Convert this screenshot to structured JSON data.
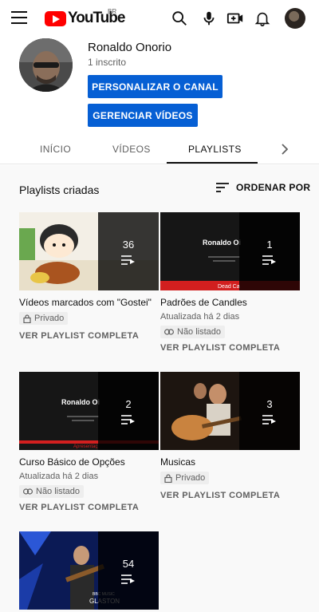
{
  "topbar": {
    "logo_text": "YouTube",
    "region": "BR",
    "icons": [
      "menu-icon",
      "search-icon",
      "microphone-icon",
      "create-video-icon",
      "notifications-icon",
      "avatar"
    ]
  },
  "channel": {
    "name": "Ronaldo Onorio",
    "subscribers": "1 inscrito",
    "customize_label": "PERSONALIZAR O CANAL",
    "manage_label": "GERENCIAR VÍDEOS"
  },
  "tabs": [
    {
      "label": "INÍCIO"
    },
    {
      "label": "VÍDEOS"
    },
    {
      "label": "PLAYLISTS",
      "active": true
    }
  ],
  "section": {
    "title": "Playlists criadas",
    "sort_label": "ORDENAR POR"
  },
  "playlists": [
    {
      "count": "36",
      "title": "Vídeos marcados com \"Gostei\"",
      "updated": "",
      "visibility": "Privado",
      "view_label": "VER PLAYLIST COMPLETA"
    },
    {
      "count": "1",
      "title": "Padrões de Candles",
      "updated": "Atualizada há 2 dias",
      "visibility": "Não listado",
      "view_label": "VER PLAYLIST COMPLETA",
      "thumb_title": "Ronaldo Oi",
      "thumb_footer": "Dead Ca"
    },
    {
      "count": "2",
      "title": "Curso Básico de Opções",
      "updated": "Atualizada há 2 dias",
      "visibility": "Não listado",
      "view_label": "VER PLAYLIST COMPLETA",
      "thumb_title": "Ronaldo Oi",
      "thumb_footer": "Apresentaç"
    },
    {
      "count": "3",
      "title": "Musicas",
      "updated": "",
      "visibility": "Privado",
      "view_label": "VER PLAYLIST COMPLETA"
    },
    {
      "count": "54",
      "thumb_brand": "BBC MUSIC",
      "thumb_caption": "GLASTON"
    }
  ],
  "colors": {
    "accent_blue": "#065fd4",
    "youtube_red": "#ff0000",
    "text_primary": "#0f0f0f",
    "text_secondary": "#606060"
  }
}
